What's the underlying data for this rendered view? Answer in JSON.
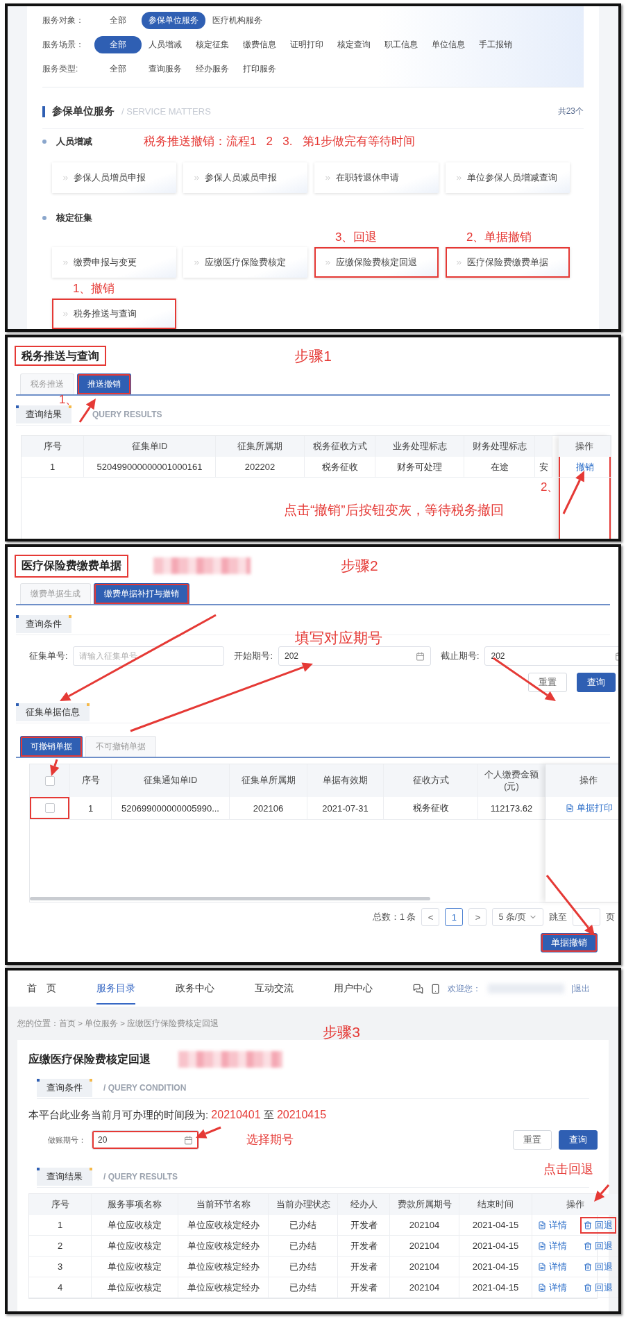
{
  "service_catalog": {
    "filters": [
      {
        "label": "服务对象：",
        "options": [
          {
            "label": "全部",
            "selected": false
          },
          {
            "label": "参保单位服务",
            "selected": true
          },
          {
            "label": "医疗机构服务",
            "selected": false
          }
        ]
      },
      {
        "label": "服务场景：",
        "options": [
          {
            "label": "全部",
            "selected": true
          },
          {
            "label": "人员增减",
            "selected": false
          },
          {
            "label": "核定征集",
            "selected": false
          },
          {
            "label": "缴费信息",
            "selected": false
          },
          {
            "label": "证明打印",
            "selected": false
          },
          {
            "label": "核定查询",
            "selected": false
          },
          {
            "label": "职工信息",
            "selected": false
          },
          {
            "label": "单位信息",
            "selected": false
          },
          {
            "label": "手工报销",
            "selected": false
          }
        ]
      },
      {
        "label": "服务类型:",
        "options": [
          {
            "label": "全部",
            "selected": false
          },
          {
            "label": "查询服务",
            "selected": false
          },
          {
            "label": "经办服务",
            "selected": false
          },
          {
            "label": "打印服务",
            "selected": false
          }
        ]
      }
    ],
    "section": {
      "title": "参保单位服务",
      "subtitle": "/ SERVICE MATTERS",
      "count": "共23个"
    },
    "groups": [
      {
        "title": "人员增减",
        "note": "税务推送撤销：流程1   2   3.   第1步做完有等待时间",
        "items": [
          {
            "label": "参保人员增员申报",
            "highlighted": false
          },
          {
            "label": "参保人员减员申报",
            "highlighted": false
          },
          {
            "label": "在职转退休申请",
            "highlighted": false
          },
          {
            "label": "单位参保人员增减查询",
            "highlighted": false
          }
        ]
      },
      {
        "title": "核定征集",
        "items": [
          {
            "label": "缴费申报与变更",
            "highlighted": false
          },
          {
            "label": "应缴医疗保险费核定",
            "highlighted": false
          },
          {
            "label": "应缴保险费核定回退",
            "note": "3、回退",
            "highlighted": true
          },
          {
            "label": "医疗保险费缴费单据",
            "note": "2、单据撤销",
            "highlighted": true
          },
          {
            "label": "税务推送与查询",
            "note": "1、撤销",
            "highlighted": true
          }
        ]
      }
    ]
  },
  "step1": {
    "title": "税务推送与查询",
    "title_highlighted": true,
    "step_label": "步骤1",
    "tabs": [
      {
        "label": "税务推送",
        "selected": false,
        "highlighted": false
      },
      {
        "label": "推送撤销",
        "selected": true,
        "highlighted": true
      }
    ],
    "tab_note": "1、",
    "section": {
      "title": "查询结果",
      "subtitle": "QUERY RESULTS"
    },
    "table": {
      "columns": [
        "序号",
        "征集单ID",
        "征集所属期",
        "税务征收方式",
        "业务处理标志",
        "财务处理标志"
      ],
      "rows": [
        {
          "cells": [
            "1",
            "520499000000001000161",
            "202202",
            "税务征收",
            "财务可处理",
            "在途"
          ],
          "partial_cell": "安",
          "action": "撤销"
        }
      ],
      "action_column": {
        "header": "操作",
        "highlighted": true
      }
    },
    "notes": {
      "marker": "2、",
      "text": "点击“撤销”后按钮变灰，等待税务撤回"
    }
  },
  "step2": {
    "title": "医疗保险费缴费单据",
    "title_highlighted": true,
    "step_label": "步骤2",
    "tabs": [
      {
        "label": "缴费单据生成",
        "selected": false,
        "highlighted": false
      },
      {
        "label": "缴费单据补打与撤销",
        "selected": true,
        "highlighted": true
      }
    ],
    "query_section": {
      "title": "查询条件"
    },
    "fields": [
      {
        "label": "征集单号:",
        "kind": "text",
        "placeholder": "请输入征集单号"
      },
      {
        "label": "开始期号:",
        "kind": "date",
        "value": "202"
      },
      {
        "label": "截止期号:",
        "kind": "date",
        "value": "202"
      }
    ],
    "field_note": "填写对应期号",
    "buttons": [
      {
        "label": "重置",
        "kind": "secondary"
      },
      {
        "label": "查询",
        "kind": "primary"
      }
    ],
    "info_section": {
      "title": "征集单据信息"
    },
    "subtabs": [
      {
        "label": "可撤销单据",
        "selected": true,
        "highlighted": true
      },
      {
        "label": "不可撤销单据",
        "selected": false,
        "highlighted": false
      }
    ],
    "table": {
      "header_checked": false,
      "columns": [
        "序号",
        "征集通知单ID",
        "征集单所属期",
        "单据有效期",
        "征收方式",
        "个人缴费金额(元)",
        "操作"
      ],
      "rows": [
        {
          "checked": false,
          "highlighted": true,
          "cells": [
            "1",
            "520699000000005990...",
            "202106",
            "2021-07-31",
            "税务征收",
            "112173.62"
          ],
          "action": "单据打印"
        }
      ]
    },
    "pagination": {
      "total": "总数：1 条",
      "prev": "<",
      "pages": [
        {
          "label": "1",
          "selected": true
        }
      ],
      "next": ">",
      "page_size": "5 条/页",
      "jump": "跳至",
      "suffix": "页"
    },
    "submit": {
      "label": "单据撤销",
      "highlighted": true
    }
  },
  "step3": {
    "nav": {
      "items": [
        {
          "label": "首　页",
          "selected": false
        },
        {
          "label": "服务目录",
          "selected": true
        },
        {
          "label": "政务中心",
          "selected": false
        },
        {
          "label": "互动交流",
          "selected": false
        },
        {
          "label": "用户中心",
          "selected": false
        }
      ],
      "welcome": "欢迎您：",
      "logout": "|退出"
    },
    "breadcrumb": "您的位置：首页 > 单位服务 > 应缴医疗保险费核定回退",
    "step_label": "步骤3",
    "title": "应缴医疗保险费核定回退",
    "query_section": {
      "title": "查询条件",
      "subtitle": "/ QUERY CONDITION"
    },
    "period_notice": {
      "text": "本平台此业务当前月可办理的时间段为:",
      "start": "20210401",
      "joiner": "至",
      "end": "20210415"
    },
    "field": {
      "label": "做账期号：",
      "value": "20",
      "highlighted": true
    },
    "field_note": "选择期号",
    "buttons": [
      {
        "label": "重置",
        "kind": "secondary"
      },
      {
        "label": "查询",
        "kind": "primary"
      }
    ],
    "result_section": {
      "title": "查询结果",
      "subtitle": "/ QUERY RESULTS"
    },
    "table_note": "点击回退",
    "table": {
      "columns": [
        "序号",
        "服务事项名称",
        "当前环节名称",
        "当前办理状态",
        "经办人",
        "费款所属期号",
        "结束时间",
        "操作"
      ],
      "rows": [
        {
          "cells": [
            "1",
            "单位应收核定",
            "单位应收核定经办",
            "已办结",
            "开发者",
            "202104",
            "2021-04-15"
          ],
          "actions": [
            {
              "kind": "detail",
              "label": "详情",
              "highlighted": false
            },
            {
              "kind": "rollback",
              "label": "回退",
              "highlighted": true
            }
          ]
        },
        {
          "cells": [
            "2",
            "单位应收核定",
            "单位应收核定经办",
            "已办结",
            "开发者",
            "202104",
            "2021-04-15"
          ],
          "actions": [
            {
              "kind": "detail",
              "label": "详情",
              "highlighted": false
            },
            {
              "kind": "rollback",
              "label": "回退",
              "highlighted": false
            }
          ]
        },
        {
          "cells": [
            "3",
            "单位应收核定",
            "单位应收核定经办",
            "已办结",
            "开发者",
            "202104",
            "2021-04-15"
          ],
          "actions": [
            {
              "kind": "detail",
              "label": "详情",
              "highlighted": false
            },
            {
              "kind": "rollback",
              "label": "回退",
              "highlighted": false
            }
          ]
        },
        {
          "cells": [
            "4",
            "单位应收核定",
            "单位应收核定经办",
            "已办结",
            "开发者",
            "202104",
            "2021-04-15"
          ],
          "actions": [
            {
              "kind": "detail",
              "label": "详情",
              "highlighted": false
            },
            {
              "kind": "rollback",
              "label": "回退",
              "highlighted": false
            }
          ]
        }
      ]
    }
  }
}
